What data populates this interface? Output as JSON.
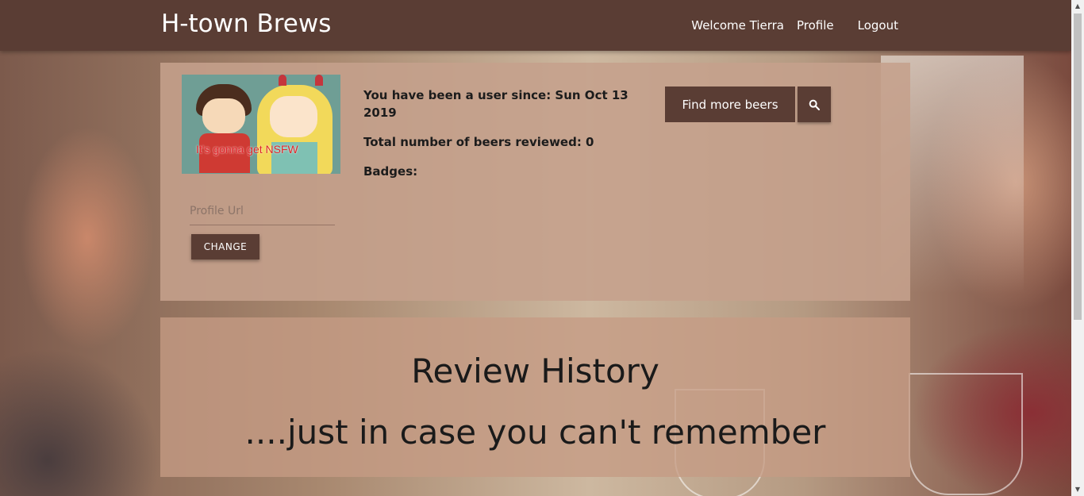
{
  "navbar": {
    "brand": "H-town Brews",
    "welcome": "Welcome Tierra",
    "profile_label": "Profile",
    "logout_label": "Logout",
    "bg_color": "#5a3d34"
  },
  "profile": {
    "avatar_caption": "It's gonna get NSFW",
    "user_since": "You have been a user since: Sun Oct 13 2019",
    "total_reviewed": "Total number of beers reviewed: 0",
    "badges": "Badges:",
    "url_placeholder": "Profile Url",
    "url_value": "",
    "change_label": "CHANGE"
  },
  "search": {
    "find_label": "Find more beers",
    "icon": "search-icon"
  },
  "history": {
    "title": "Review History",
    "subtitle": "....just in case you can't remember"
  },
  "colors": {
    "accent": "#5a3d34",
    "panel": "#c5a08c"
  }
}
